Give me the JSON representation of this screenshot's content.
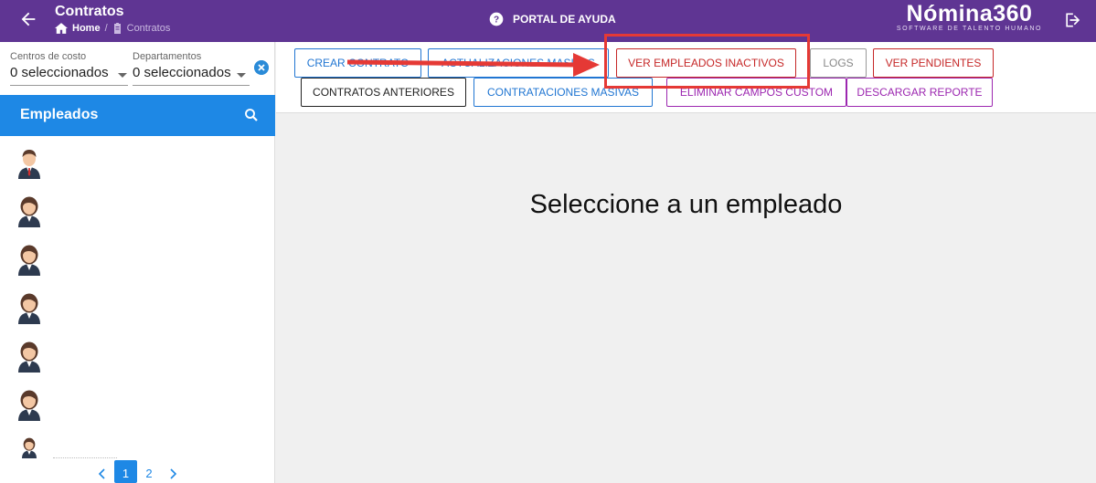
{
  "header": {
    "title": "Contratos",
    "breadcrumb": {
      "home": "Home",
      "sep": "/",
      "current": "Contratos"
    },
    "portal_label": "PORTAL DE AYUDA",
    "logo": {
      "brand": "Nómina360",
      "tagline": "SOFTWARE DE TALENTO HUMANO"
    }
  },
  "filters": {
    "cost_centers": {
      "label": "Centros de costo",
      "value": "0 seleccionados"
    },
    "departments": {
      "label": "Departamentos",
      "value": "0 seleccionados"
    }
  },
  "employees": {
    "header": "Empleados",
    "avatars": [
      "male",
      "female",
      "female",
      "female",
      "female",
      "female",
      "female"
    ]
  },
  "pagination": {
    "prev": "‹",
    "pages": [
      "1",
      "2"
    ],
    "active": "1",
    "next": "›"
  },
  "toolbar": {
    "row1": {
      "crear": "CREAR CONTRATO",
      "actualizaciones": "ACTUALIZACIONES MASIVAS",
      "ver_inactivos": "VER EMPLEADOS INACTIVOS",
      "logs": "LOGS",
      "ver_pendientes": "VER PENDIENTES"
    },
    "row2": {
      "anteriores": "CONTRATOS ANTERIORES",
      "contrataciones": "CONTRATACIONES MASIVAS",
      "eliminar": "ELIMINAR CAMPOS CUSTOM",
      "descargar": "DESCARGAR REPORTE"
    }
  },
  "main": {
    "message": "Seleccione a un empleado"
  },
  "colors": {
    "topbar": "#5f3593",
    "accent_blue": "#1e88e5",
    "annotation_red": "#e53935"
  }
}
